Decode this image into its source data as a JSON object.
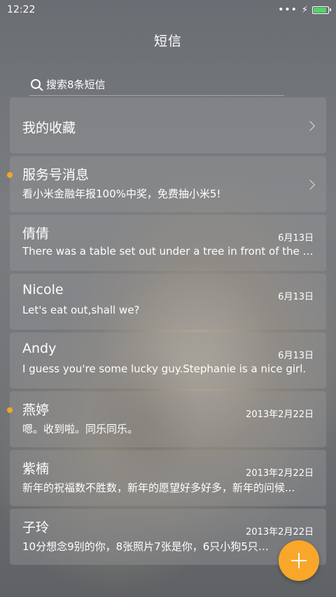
{
  "status_bar": {
    "time": "12:22",
    "signal": "•••",
    "battery_level": 0.95
  },
  "header": {
    "title": "短信"
  },
  "search": {
    "placeholder": "搜索8条短信"
  },
  "favorites": {
    "label": "我的收藏"
  },
  "service": {
    "name": "服务号消息",
    "preview": "看小米金融年报100%中奖，免费抽小米5!"
  },
  "conversations": [
    {
      "name": "倩倩",
      "date": "6月13日",
      "preview": "There was a table set out under a tree in front of the ho...",
      "unread": false
    },
    {
      "name": "Nicole",
      "date": "6月13日",
      "preview": "Let's eat out,shall we?",
      "unread": false
    },
    {
      "name": "Andy",
      "date": "6月13日",
      "preview": "I guess you're some lucky guy.Stephanie is a nice girl.",
      "unread": false
    },
    {
      "name": "燕婷",
      "date": "2013年2月22日",
      "preview": "嗯。收到啦。同乐同乐。",
      "unread": true
    },
    {
      "name": "紫楠",
      "date": "2013年2月22日",
      "preview": "新年的祝福数不胜数，新年的愿望好多好多，新年的问候...",
      "unread": false
    },
    {
      "name": "子玲",
      "date": "2013年2月22日",
      "preview": "10分想念9别的你，8张照片7张是你，6只小狗5只像你...",
      "unread": false
    }
  ],
  "colors": {
    "accent": "#f8a72a",
    "unread_dot": "#f5a623",
    "battery": "#4cd964"
  },
  "icons": {
    "search": "search-icon",
    "chevron": "chevron-right-icon",
    "fab": "plus-icon"
  }
}
